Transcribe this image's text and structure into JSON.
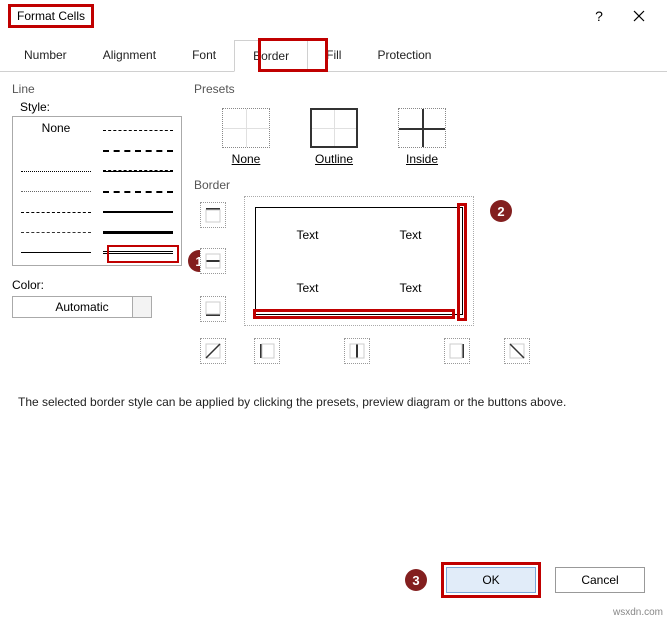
{
  "title": "Format Cells",
  "tabs": [
    "Number",
    "Alignment",
    "Font",
    "Border",
    "Fill",
    "Protection"
  ],
  "active_tab": "Border",
  "line": {
    "group": "Line",
    "style_label": "Style:",
    "none": "None",
    "color_label": "Color:",
    "color_value": "Automatic"
  },
  "presets": {
    "group": "Presets",
    "none": "None",
    "outline": "Outline",
    "inside": "Inside"
  },
  "border": {
    "group": "Border",
    "cell_text": "Text"
  },
  "hint": "The selected border style can be applied by clicking the presets, preview diagram or the buttons above.",
  "buttons": {
    "ok": "OK",
    "cancel": "Cancel"
  },
  "badges": {
    "style": "1",
    "preview": "2",
    "ok": "3"
  },
  "watermark": "wsxdn.com"
}
